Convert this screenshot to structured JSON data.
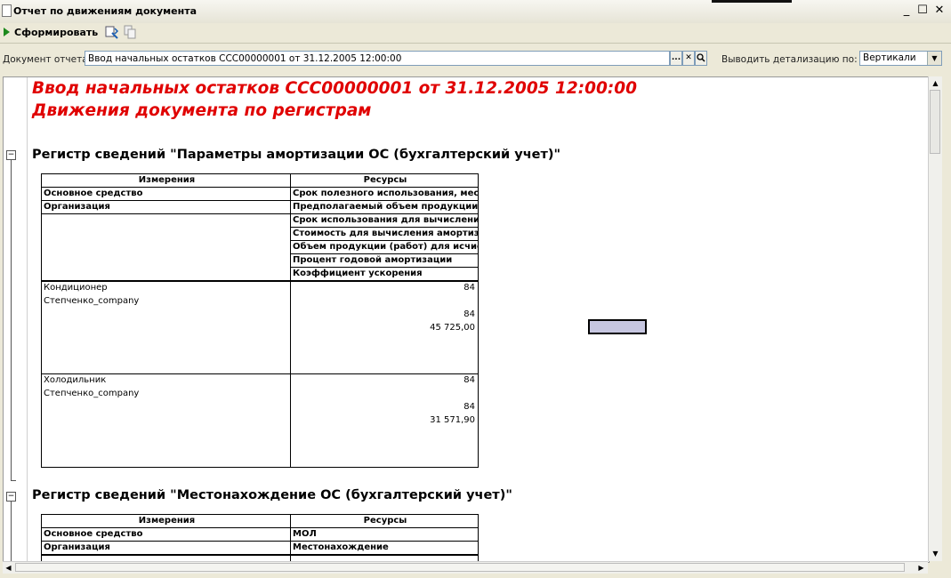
{
  "window": {
    "title": "Отчет по движениям документа",
    "minimize": "_",
    "maximize": "☐",
    "close": "✕"
  },
  "toolbar": {
    "generate_label": "Сформировать"
  },
  "params": {
    "doc_label": "Документ отчета:",
    "doc_value": "Ввод начальных остатков ССС00000001 от 31.12.2005 12:00:00",
    "select_btn": "...",
    "clear_btn": "✕",
    "open_btn": "🔍",
    "detail_label": "Выводить детализацию по:",
    "detail_value": "Вертикали"
  },
  "report": {
    "title1": "Ввод начальных остатков ССС00000001 от 31.12.2005 12:00:00",
    "title2": "Движения документа по регистрам",
    "register1": {
      "title": "Регистр сведений \"Параметры амортизации ОС (бухгалтерский учет)\"",
      "hdr_dims": "Измерения",
      "hdr_res": "Ресурсы",
      "dims": [
        "Основное средство",
        "Организация"
      ],
      "res": [
        "Срок полезного использования, мес.",
        "Предполагаемый объем продукции (",
        "Срок использования для вычисления",
        "Стоимость для вычисления амортиза",
        "Объем продукции (работ) для исчисл",
        "Процент годовой амортизации",
        "Коэффициент ускорения"
      ],
      "rows": [
        {
          "asset": "Кондиционер",
          "org": "Степченко_company",
          "v1": "84",
          "v2": "84",
          "v3": "45 725,00"
        },
        {
          "asset": "Холодильник",
          "org": "Степченко_company",
          "v1": "84",
          "v2": "84",
          "v3": "31 571,90"
        }
      ]
    },
    "register2": {
      "title": "Регистр сведений \"Местонахождение ОС (бухгалтерский учет)\"",
      "hdr_dims": "Измерения",
      "hdr_res": "Ресурсы",
      "dims": [
        "Основное средство",
        "Организация"
      ],
      "res": [
        "МОЛ",
        "Местонахождение"
      ]
    }
  }
}
